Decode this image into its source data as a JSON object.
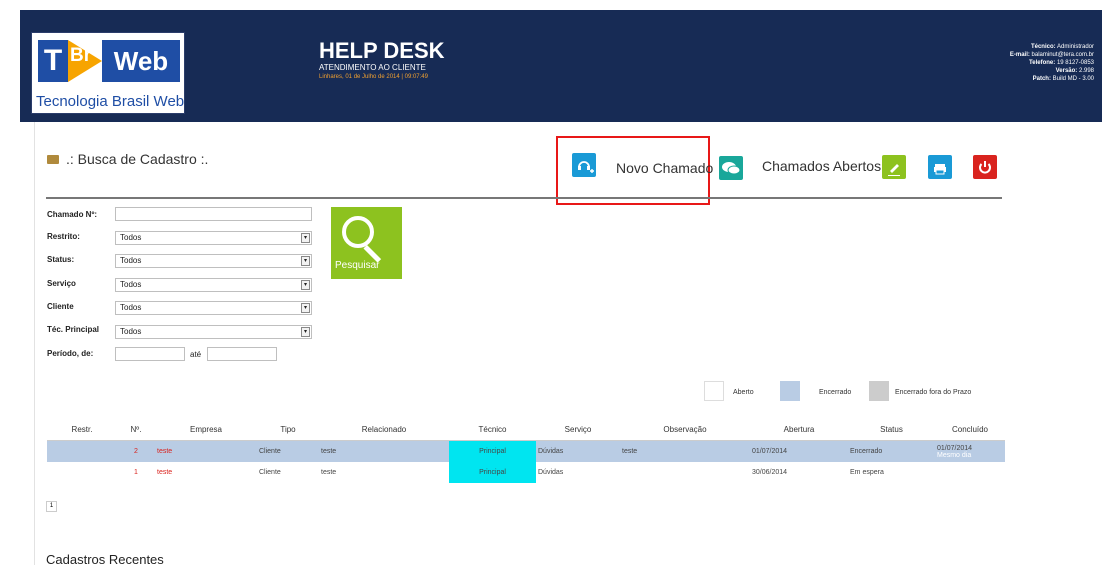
{
  "header": {
    "logo": {
      "t": "T",
      "br": "Br",
      "web": "Web",
      "subtitle": "Tecnologia Brasil Web"
    },
    "title": "HELP DESK",
    "subtitle": "ATENDIMENTO AO CLIENTE",
    "datetime": "Linhares, 01 de Julho de 2014  |  09:07:49",
    "info": [
      {
        "label": "Técnico:",
        "value": "Administrador"
      },
      {
        "label": "E-mail:",
        "value": "balaminut@tera.com.br"
      },
      {
        "label": "Telefone:",
        "value": "19 8127-0853"
      },
      {
        "label": "Versão:",
        "value": "2.998"
      },
      {
        "label": "Patch:",
        "value": "Build MD - 3.00"
      }
    ]
  },
  "page": {
    "title": ".: Busca de Cadastro :."
  },
  "toolbar": {
    "novo_chamado": "Novo Chamado",
    "chamados_abertos": "Chamados Abertos",
    "colors": {
      "blue": "#1a9ad6",
      "teal": "#19a79a",
      "green": "#8dc21f",
      "red": "#d9231e"
    }
  },
  "form": {
    "chamado_label": "Chamado Nº:",
    "chamado_value": "",
    "restrito_label": "Restrito:",
    "restrito_value": "Todos",
    "status_label": "Status:",
    "status_value": "Todos",
    "servico_label": "Serviço",
    "servico_value": "Todos",
    "cliente_label": "Cliente",
    "cliente_value": "Todos",
    "tec_label": "Téc. Principal",
    "tec_value": "Todos",
    "periodo_label": "Período, de:",
    "ate_label": "até",
    "search_label": "Pesquisar"
  },
  "legend": [
    {
      "label": "Aberto",
      "color": "#ffffff"
    },
    {
      "label": "Encerrado",
      "color": "#b9cce4"
    },
    {
      "label": "Encerrado fora do Prazo",
      "color": "#cccccc"
    }
  ],
  "table": {
    "headers": [
      "Restr.",
      "Nº.",
      "Empresa",
      "Tipo",
      "Relacionado",
      "Técnico",
      "Serviço",
      "Observação",
      "Abertura",
      "Status",
      "Concluído"
    ],
    "rows": [
      {
        "restr": "",
        "num": "2",
        "empresa": "teste",
        "tipo": "Cliente",
        "relacionado": "teste",
        "tecnico": "Principal",
        "servico": "Dúvidas",
        "observacao": "teste",
        "abertura": "01/07/2014",
        "status": "Encerrado",
        "concluido": "01/07/2014",
        "concluido_note": "Mesmo dia"
      },
      {
        "restr": "",
        "num": "1",
        "empresa": "teste",
        "tipo": "Cliente",
        "relacionado": "teste",
        "tecnico": "Principal",
        "servico": "Dúvidas",
        "observacao": "",
        "abertura": "30/06/2014",
        "status": "Em espera",
        "concluido": "",
        "concluido_note": ""
      }
    ]
  },
  "pager": {
    "current": "1"
  },
  "recent": {
    "title": "Cadastros Recentes"
  }
}
